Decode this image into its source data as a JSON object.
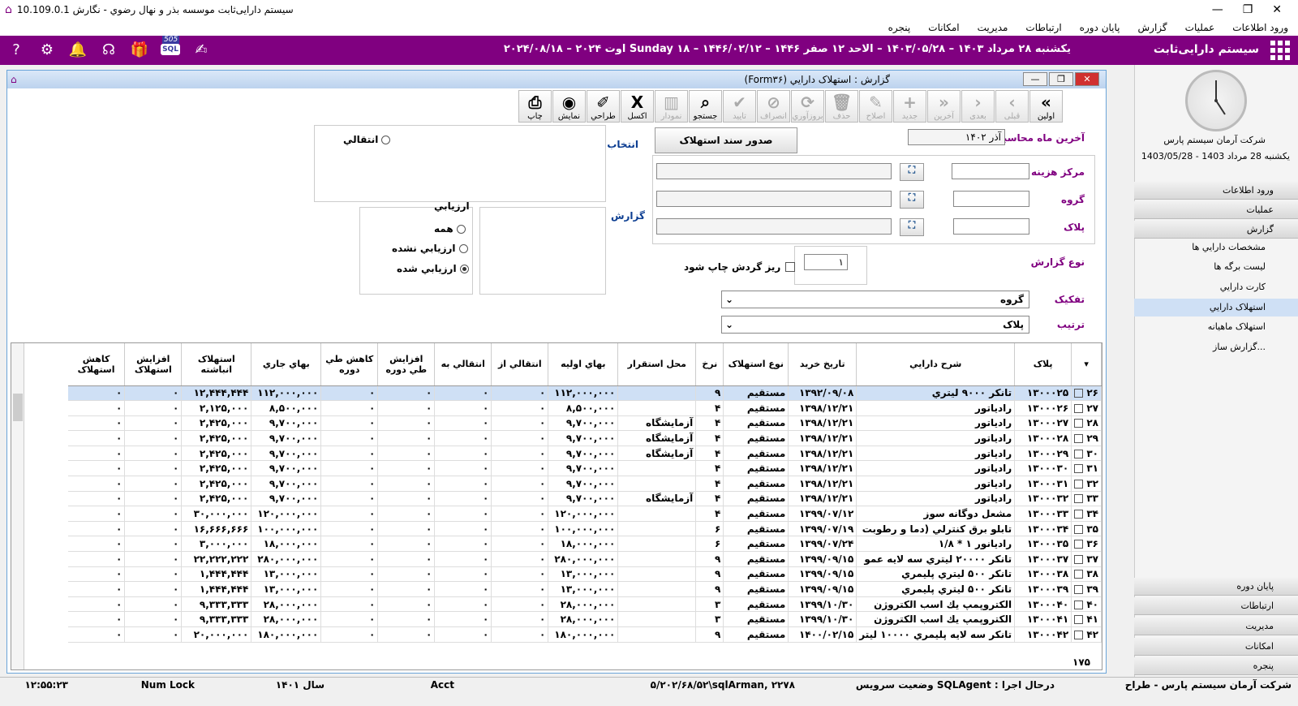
{
  "titlebar": {
    "title": "سیستم دارایی‌ثابت موسسه بذر و نهال رضوي - نگارش 10.109.0.1",
    "min": "—",
    "max": "❐",
    "close": "✕"
  },
  "menu": [
    "ورود اطلاعات",
    "عمليات",
    "گزارش",
    "پايان دوره",
    "ارتباطات",
    "مديريت",
    "امکانات",
    "پنجره"
  ],
  "header": {
    "brand": "سیستم دارایی‌ثابت",
    "date": "يکشنبه ۲۸ مرداد ۱۴۰۳ – ۱۴۰۳/۰۵/۲۸ – الاحد ۱۲ صفر ۱۴۴۶ – ۱۴۴۶/۰۲/۱۲ – Sunday ۱۸ اوت ۲۰۲۴ – ۲۰۲۴/۰۸/۱۸",
    "badge": "505",
    "sql": "SQL"
  },
  "side": {
    "company": "شرکت آرمان سیستم پارس",
    "date": "يکشنبه 28 مرداد 1403 - 1403/05/28",
    "nav": [
      {
        "label": "ورود اطلاعات"
      },
      {
        "label": "عمليات"
      },
      {
        "label": "گزارش"
      }
    ],
    "sub": [
      "مشخصات دارايي ها",
      "ليست برگه ها",
      "کارت دارايي",
      "استهلاک دارايي",
      "استهلاک ماهيانه",
      "...گزارش ساز"
    ],
    "nav2": [
      "پايان دوره",
      "ارتباطات",
      "مديريت",
      "امکانات",
      "پنجره"
    ]
  },
  "window": {
    "title": "گزارش : استهلاک دارايي (Form۳۶)"
  },
  "toolbar": [
    {
      "l": "اولين",
      "i": "»",
      "d": false
    },
    {
      "l": "قبلی",
      "i": "›",
      "d": true
    },
    {
      "l": "بعدی",
      "i": "‹",
      "d": true
    },
    {
      "l": "آخرين",
      "i": "«",
      "d": true
    },
    {
      "l": "جديد",
      "i": "+",
      "d": true
    },
    {
      "l": "اصلاح",
      "i": "✎",
      "d": true
    },
    {
      "l": "حذف",
      "i": "🗑",
      "d": true
    },
    {
      "l": "بروزآوري",
      "i": "⟳",
      "d": true
    },
    {
      "l": "انصراف",
      "i": "⊘",
      "d": true
    },
    {
      "l": "تاييد",
      "i": "✔",
      "d": true
    },
    {
      "l": "جستجو",
      "i": "⌕",
      "d": false
    },
    {
      "l": "نمودار",
      "i": "▥",
      "d": true
    },
    {
      "l": "اکسل",
      "i": "X",
      "d": false
    },
    {
      "l": "طراحي",
      "i": "✐",
      "d": false
    },
    {
      "l": "نمايش",
      "i": "◉",
      "d": false
    },
    {
      "l": "چاپ",
      "i": "⎙",
      "d": false
    }
  ],
  "form": {
    "lastMonthLabel": "آخرين ماه محاسبه",
    "lastMonth": "آذر ۱۴۰۲",
    "issue": "صدور سند استهلاک",
    "select": "انتخاب",
    "report": "گزارش",
    "transfer": "انتقالي",
    "cost": "مرکز هزينه",
    "group": "گروه",
    "tag": "پلاک",
    "eval": "ارزيابي",
    "all": "همه",
    "notEval": "ارزيابي نشده",
    "evaled": "ارزيابي شده",
    "reportType": "نوع گزارش",
    "typeVal": "۱",
    "sub": "ريز گردش چاپ شود",
    "sep": "تفکيک",
    "sepVal": "گروه",
    "order": "ترتيب",
    "orderVal": "پلاک"
  },
  "columns": [
    "پلاک",
    "شرح دارايي",
    "تاريخ خريد",
    "نوع استهلاک",
    "نرخ",
    "محل استقرار",
    "بهاي اوليه",
    "انتقالي از",
    "انتقالي به",
    "افزايش طي دوره",
    "کاهش طي دوره",
    "بهاي جاري",
    "استهلاک انباشته",
    "افزايش استهلاک",
    "کاهش استهلاک"
  ],
  "rows": [
    [
      "۲۶",
      "۱۳۰۰۰۲۵",
      "تانکر ۹۰۰۰ ليتري",
      "۱۳۹۲/۰۹/۰۸",
      "مستقيم",
      "۹",
      "",
      "۱۱۲,۰۰۰,۰۰۰",
      "۰",
      "۰",
      "۰",
      "۰",
      "۱۱۲,۰۰۰,۰۰۰",
      "۱۲,۴۴۴,۴۴۴",
      "۰",
      "۰"
    ],
    [
      "۲۷",
      "۱۳۰۰۰۲۶",
      "رادياتور",
      "۱۳۹۸/۱۲/۲۱",
      "مستقيم",
      "۴",
      "",
      "۸,۵۰۰,۰۰۰",
      "۰",
      "۰",
      "۰",
      "۰",
      "۸,۵۰۰,۰۰۰",
      "۲,۱۲۵,۰۰۰",
      "۰",
      "۰"
    ],
    [
      "۲۸",
      "۱۳۰۰۰۲۷",
      "رادياتور",
      "۱۳۹۸/۱۲/۲۱",
      "مستقيم",
      "۴",
      "آزمايشگاه",
      "۹,۷۰۰,۰۰۰",
      "۰",
      "۰",
      "۰",
      "۰",
      "۹,۷۰۰,۰۰۰",
      "۲,۴۲۵,۰۰۰",
      "۰",
      "۰"
    ],
    [
      "۲۹",
      "۱۳۰۰۰۲۸",
      "رادياتور",
      "۱۳۹۸/۱۲/۲۱",
      "مستقيم",
      "۴",
      "آزمايشگاه",
      "۹,۷۰۰,۰۰۰",
      "۰",
      "۰",
      "۰",
      "۰",
      "۹,۷۰۰,۰۰۰",
      "۲,۴۲۵,۰۰۰",
      "۰",
      "۰"
    ],
    [
      "۳۰",
      "۱۳۰۰۰۲۹",
      "رادياتور",
      "۱۳۹۸/۱۲/۲۱",
      "مستقيم",
      "۴",
      "آزمايشگاه",
      "۹,۷۰۰,۰۰۰",
      "۰",
      "۰",
      "۰",
      "۰",
      "۹,۷۰۰,۰۰۰",
      "۲,۴۲۵,۰۰۰",
      "۰",
      "۰"
    ],
    [
      "۳۱",
      "۱۳۰۰۰۳۰",
      "رادياتور",
      "۱۳۹۸/۱۲/۲۱",
      "مستقيم",
      "۴",
      "",
      "۹,۷۰۰,۰۰۰",
      "۰",
      "۰",
      "۰",
      "۰",
      "۹,۷۰۰,۰۰۰",
      "۲,۴۲۵,۰۰۰",
      "۰",
      "۰"
    ],
    [
      "۳۲",
      "۱۳۰۰۰۳۱",
      "رادياتور",
      "۱۳۹۸/۱۲/۲۱",
      "مستقيم",
      "۴",
      "",
      "۹,۷۰۰,۰۰۰",
      "۰",
      "۰",
      "۰",
      "۰",
      "۹,۷۰۰,۰۰۰",
      "۲,۴۲۵,۰۰۰",
      "۰",
      "۰"
    ],
    [
      "۳۳",
      "۱۳۰۰۰۳۲",
      "رادياتور",
      "۱۳۹۸/۱۲/۲۱",
      "مستقيم",
      "۴",
      "آزمايشگاه",
      "۹,۷۰۰,۰۰۰",
      "۰",
      "۰",
      "۰",
      "۰",
      "۹,۷۰۰,۰۰۰",
      "۲,۴۲۵,۰۰۰",
      "۰",
      "۰"
    ],
    [
      "۳۴",
      "۱۳۰۰۰۳۳",
      "مشعل دوگانه سوز",
      "۱۳۹۹/۰۷/۱۲",
      "مستقيم",
      "۴",
      "",
      "۱۲۰,۰۰۰,۰۰۰",
      "۰",
      "۰",
      "۰",
      "۰",
      "۱۲۰,۰۰۰,۰۰۰",
      "۳۰,۰۰۰,۰۰۰",
      "۰",
      "۰"
    ],
    [
      "۳۵",
      "۱۳۰۰۰۳۴",
      "تابلو برق کنترلي (دما و رطوبت",
      "۱۳۹۹/۰۷/۱۹",
      "مستقيم",
      "۶",
      "",
      "۱۰۰,۰۰۰,۰۰۰",
      "۰",
      "۰",
      "۰",
      "۰",
      "۱۰۰,۰۰۰,۰۰۰",
      "۱۶,۶۶۶,۶۶۶",
      "۰",
      "۰"
    ],
    [
      "۳۶",
      "۱۳۰۰۰۳۵",
      "راديانور ۱ * ۱/۸",
      "۱۳۹۹/۰۷/۲۴",
      "مستقيم",
      "۶",
      "",
      "۱۸,۰۰۰,۰۰۰",
      "۰",
      "۰",
      "۰",
      "۰",
      "۱۸,۰۰۰,۰۰۰",
      "۳,۰۰۰,۰۰۰",
      "۰",
      "۰"
    ],
    [
      "۳۷",
      "۱۳۰۰۰۳۷",
      "تانکر ۲۰۰۰۰ ليتري سه لايه عمو",
      "۱۳۹۹/۰۹/۱۵",
      "مستقيم",
      "۹",
      "",
      "۲۸۰,۰۰۰,۰۰۰",
      "۰",
      "۰",
      "۰",
      "۰",
      "۲۸۰,۰۰۰,۰۰۰",
      "۲۲,۲۲۲,۲۲۲",
      "۰",
      "۰"
    ],
    [
      "۳۸",
      "۱۳۰۰۰۳۸",
      "تانکر ۵۰۰ ليتري پليمري",
      "۱۳۹۹/۰۹/۱۵",
      "مستقيم",
      "۹",
      "",
      "۱۳,۰۰۰,۰۰۰",
      "۰",
      "۰",
      "۰",
      "۰",
      "۱۳,۰۰۰,۰۰۰",
      "۱,۴۴۴,۴۴۴",
      "۰",
      "۰"
    ],
    [
      "۳۹",
      "۱۳۰۰۰۳۹",
      "تانکر ۵۰۰ ليتري پليمري",
      "۱۳۹۹/۰۹/۱۵",
      "مستقيم",
      "۹",
      "",
      "۱۳,۰۰۰,۰۰۰",
      "۰",
      "۰",
      "۰",
      "۰",
      "۱۳,۰۰۰,۰۰۰",
      "۱,۴۴۴,۴۴۴",
      "۰",
      "۰"
    ],
    [
      "۴۰",
      "۱۳۰۰۰۴۰",
      "الکتروپمپ يك اسب الکتروژن",
      "۱۳۹۹/۱۰/۳۰",
      "مستقيم",
      "۳",
      "",
      "۲۸,۰۰۰,۰۰۰",
      "۰",
      "۰",
      "۰",
      "۰",
      "۲۸,۰۰۰,۰۰۰",
      "۹,۳۳۳,۳۳۳",
      "۰",
      "۰"
    ],
    [
      "۴۱",
      "۱۳۰۰۰۴۱",
      "الکتروپمپ يك اسب الکتروژن",
      "۱۳۹۹/۱۰/۳۰",
      "مستقيم",
      "۳",
      "",
      "۲۸,۰۰۰,۰۰۰",
      "۰",
      "۰",
      "۰",
      "۰",
      "۲۸,۰۰۰,۰۰۰",
      "۹,۳۳۳,۳۳۳",
      "۰",
      "۰"
    ],
    [
      "۴۲",
      "۱۳۰۰۰۴۲",
      "تانکر سه لايه پليمري ۱۰۰۰۰ ليتر",
      "۱۴۰۰/۰۲/۱۵",
      "مستقيم",
      "۹",
      "",
      "۱۸۰,۰۰۰,۰۰۰",
      "۰",
      "۰",
      "۰",
      "۰",
      "۱۸۰,۰۰۰,۰۰۰",
      "۲۰,۰۰۰,۰۰۰",
      "۰",
      "۰"
    ]
  ],
  "total": "۱۷۵",
  "status": {
    "company": "شرکت آرمان سيستم پارس - طراح",
    "agent": "درحال اجرا : SQLAgent وضعيت سرويس",
    "conn": "۵/۲۰۲/۶۸/۵۲\\sqlArman, ۲۲۷۸",
    "acct": "Acct",
    "year": "سال ۱۴۰۱",
    "num": "Num Lock",
    "time": "۱۲:۵۵:۲۳"
  }
}
